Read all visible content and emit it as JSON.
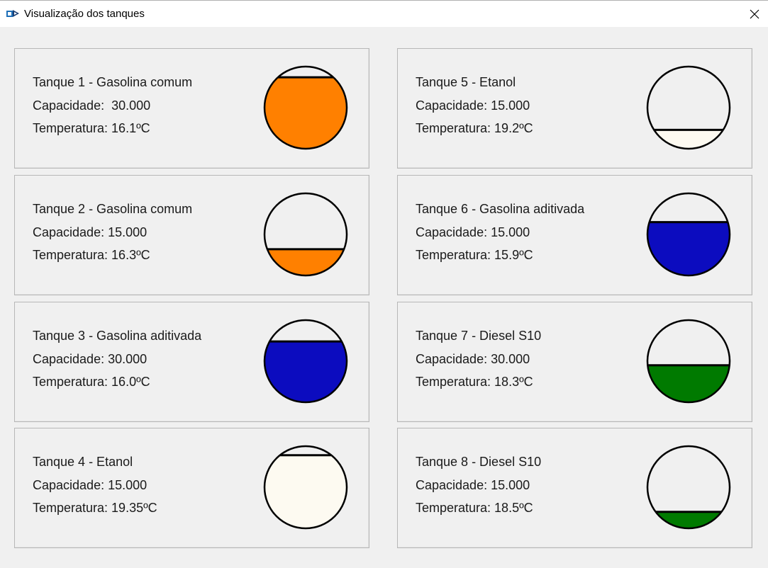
{
  "window": {
    "title": "Visualização dos tanques"
  },
  "tanks": [
    {
      "title": "Tanque 1 - Gasolina comum",
      "capacity": "Capacidade:  30.000",
      "temperature": "Temperatura: 16.1ºC",
      "level": 0.87,
      "color": "#ff8000"
    },
    {
      "title": "Tanque 2 - Gasolina comum",
      "capacity": "Capacidade: 15.000",
      "temperature": "Temperatura: 16.3ºC",
      "level": 0.32,
      "color": "#ff8000"
    },
    {
      "title": "Tanque 3 - Gasolina aditivada",
      "capacity": "Capacidade: 30.000",
      "temperature": "Temperatura: 16.0ºC",
      "level": 0.74,
      "color": "#0c0cbf"
    },
    {
      "title": "Tanque 4 - Etanol",
      "capacity": "Capacidade: 15.000",
      "temperature": "Temperatura: 19.35ºC",
      "level": 0.89,
      "color": "#fdfaf1"
    },
    {
      "title": "Tanque 5 - Etanol",
      "capacity": "Capacidade: 15.000",
      "temperature": "Temperatura: 19.2ºC",
      "level": 0.23,
      "color": "#fdfaf1"
    },
    {
      "title": "Tanque 6 - Gasolina aditivada",
      "capacity": "Capacidade: 15.000",
      "temperature": "Temperatura: 15.9ºC",
      "level": 0.65,
      "color": "#0c0cbf"
    },
    {
      "title": "Tanque 7 - Diesel S10",
      "capacity": "Capacidade: 30.000",
      "temperature": "Temperatura: 18.3ºC",
      "level": 0.45,
      "color": "#007a00"
    },
    {
      "title": "Tanque 8 - Diesel S10",
      "capacity": "Capacidade: 15.000",
      "temperature": "Temperatura: 18.5ºC",
      "level": 0.2,
      "color": "#007a00"
    }
  ]
}
